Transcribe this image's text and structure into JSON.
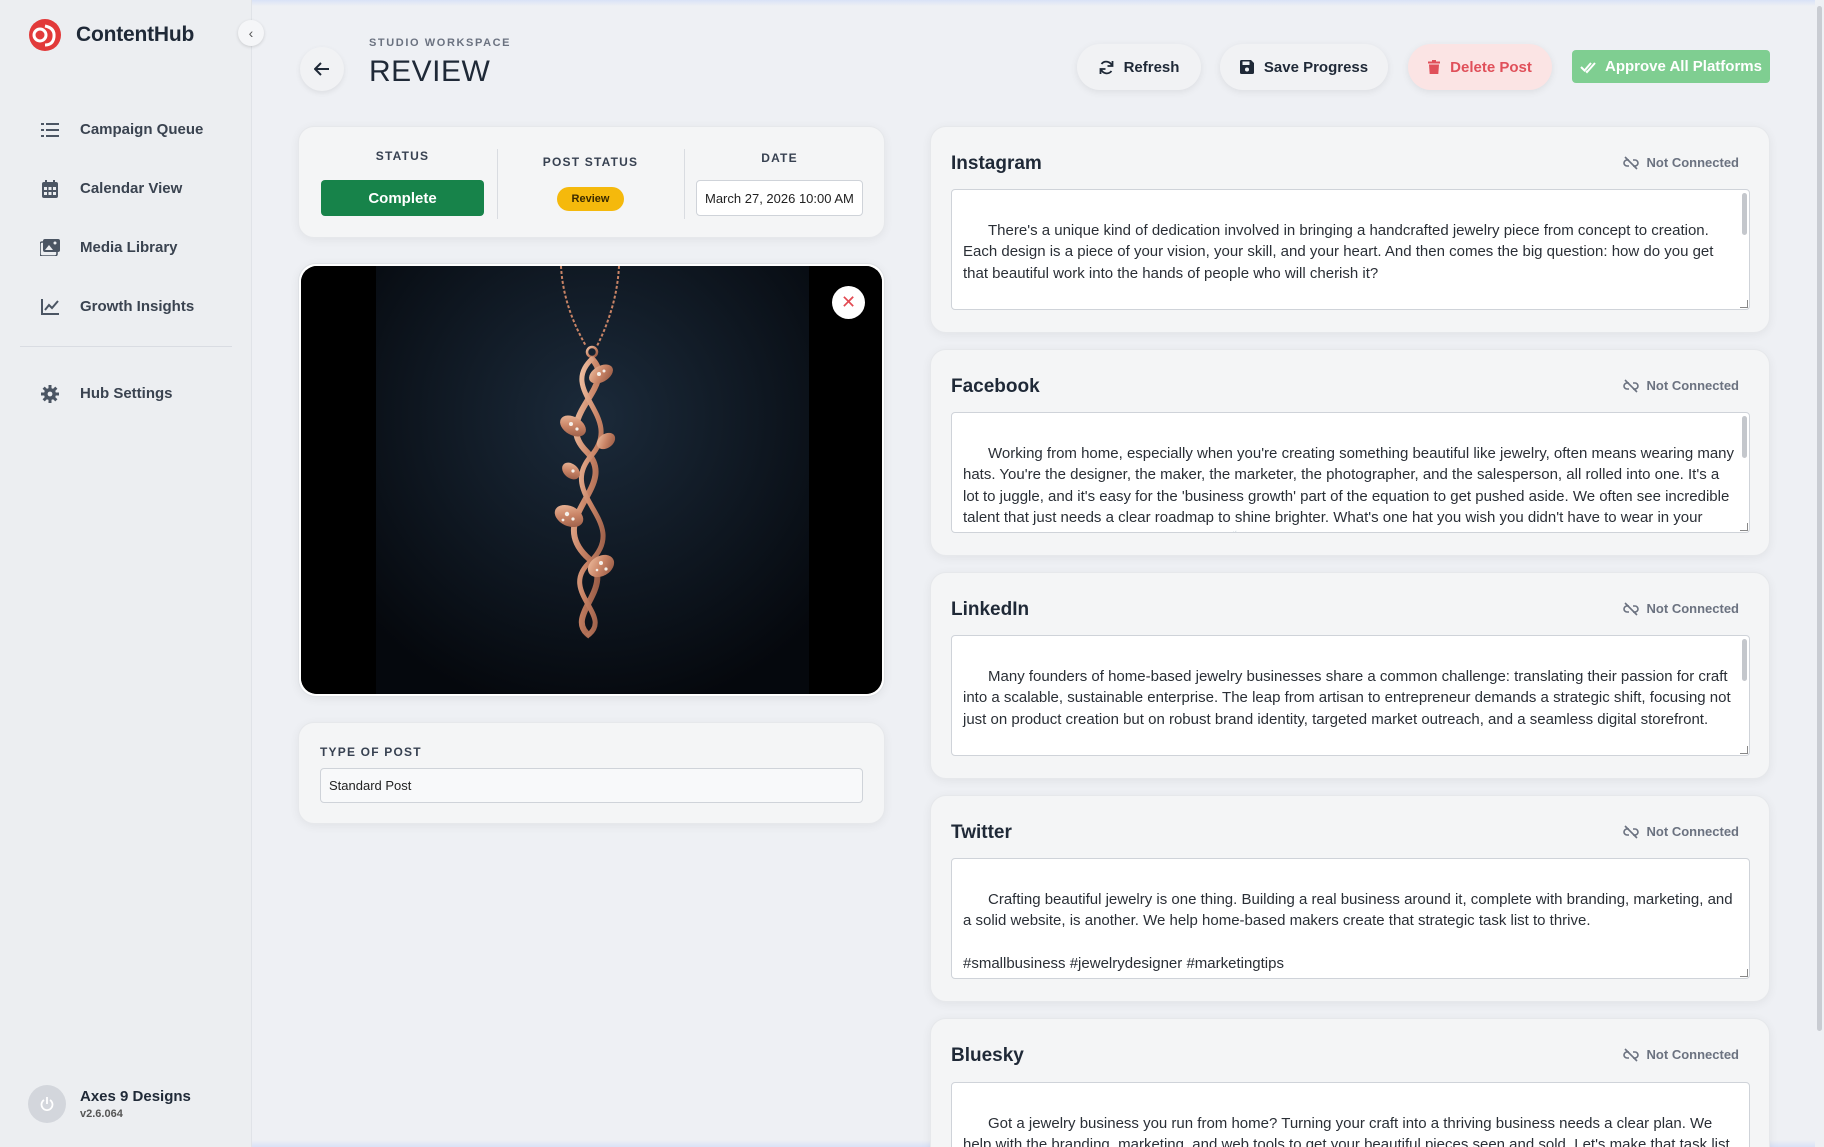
{
  "app": {
    "name": "ContentHub"
  },
  "sidebar": {
    "items": [
      {
        "label": "Campaign Queue",
        "icon": "list-icon"
      },
      {
        "label": "Calendar View",
        "icon": "calendar-icon"
      },
      {
        "label": "Media Library",
        "icon": "images-icon"
      },
      {
        "label": "Growth Insights",
        "icon": "chart-line-icon"
      }
    ],
    "settings": {
      "label": "Hub Settings",
      "icon": "gear-icon"
    },
    "user": {
      "name": "Axes 9 Designs",
      "version": "v2.6.064"
    }
  },
  "header": {
    "eyebrow": "STUDIO WORKSPACE",
    "title": "REVIEW",
    "refresh_label": "Refresh",
    "save_label": "Save Progress",
    "delete_label": "Delete Post",
    "approve_label": "Approve All Platforms"
  },
  "status": {
    "status_label": "STATUS",
    "status_value": "Complete",
    "post_status_label": "POST STATUS",
    "post_status_value": "Review",
    "date_label": "DATE",
    "date_value": "March 27, 2026 10:00 AM"
  },
  "post_type": {
    "label": "TYPE OF POST",
    "value": "Standard Post"
  },
  "platforms": [
    {
      "name": "Instagram",
      "status": "Not Connected",
      "text": "There's a unique kind of dedication involved in bringing a handcrafted jewelry piece from concept to creation. Each design is a piece of your vision, your skill, and your heart. And then comes the big question: how do you get that beautiful work into the hands of people who will cherish it?\n\nTurning a passion for jewelry into a thriving small business at home requires more than just making stunning"
    },
    {
      "name": "Facebook",
      "status": "Not Connected",
      "text": "Working from home, especially when you're creating something beautiful like jewelry, often means wearing many hats. You're the designer, the maker, the marketer, the photographer, and the salesperson, all rolled into one. It's a lot to juggle, and it's easy for the 'business growth' part of the equation to get pushed aside. We often see incredible talent that just needs a clear roadmap to shine brighter. What's one hat you wish you didn't have to wear in your business? Share your thoughts below! 👏"
    },
    {
      "name": "LinkedIn",
      "status": "Not Connected",
      "text": "Many founders of home-based jewelry businesses share a common challenge: translating their passion for craft into a scalable, sustainable enterprise. The leap from artisan to entrepreneur demands a strategic shift, focusing not just on product creation but on robust brand identity, targeted market outreach, and a seamless digital storefront."
    },
    {
      "name": "Twitter",
      "status": "Not Connected",
      "text": "Crafting beautiful jewelry is one thing. Building a real business around it, complete with branding, marketing, and a solid website, is another. We help home-based makers create that strategic task list to thrive.\n\n#smallbusiness #jewelrydesigner #marketingtips"
    },
    {
      "name": "Bluesky",
      "status": "Not Connected",
      "text": "Got a jewelry business you run from home? Turning your craft into a thriving business needs a clear plan. We help with the branding, marketing, and web tools to get your beautiful pieces seen and sold. Let's make that task list work for you."
    }
  ],
  "colors": {
    "complete": "#17834a",
    "review": "#f5b90c",
    "delete_bg": "#fbe4e4",
    "delete_text": "#e0505a",
    "approve": "#7fce91",
    "brand": "#e23a3a"
  }
}
